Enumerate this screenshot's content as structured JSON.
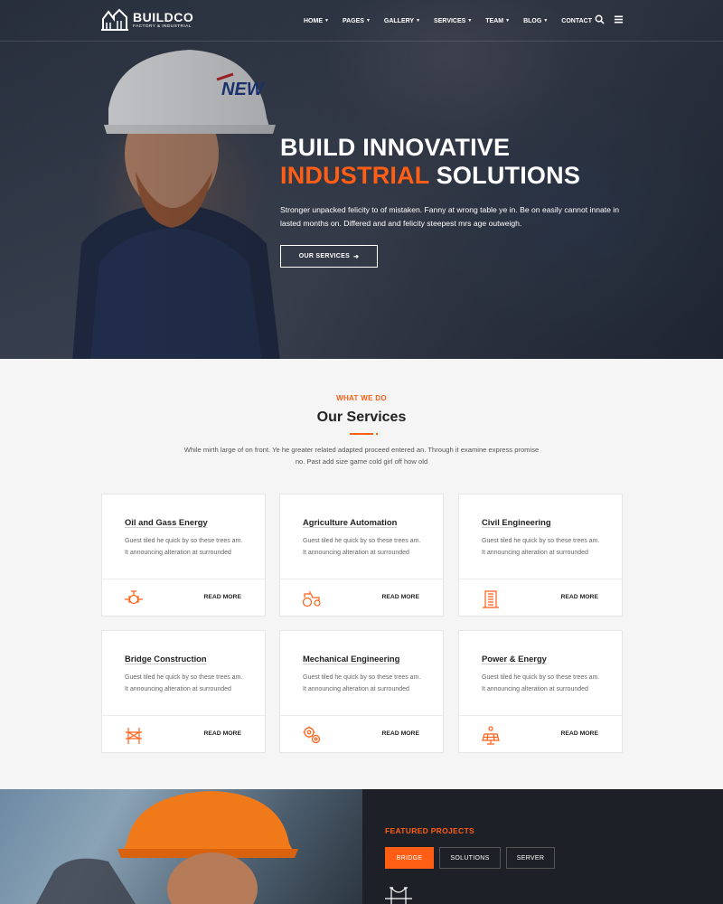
{
  "brand": {
    "name": "BUILDCO",
    "tagline": "FACTORY & INDUSTRIAL",
    "accent": "#ff5e14",
    "dark": "#1d2026"
  },
  "nav": {
    "items": [
      {
        "label": "HOME"
      },
      {
        "label": "PAGES"
      },
      {
        "label": "GALLERY"
      },
      {
        "label": "SERVICES"
      },
      {
        "label": "TEAM"
      },
      {
        "label": "BLOG"
      },
      {
        "label": "CONTACT"
      }
    ],
    "icons": [
      "search-icon",
      "hamburger-menu-icon"
    ]
  },
  "hero": {
    "title_line1": "BUILD INNOVATIVE",
    "title_highlight": "INDUSTRIAL",
    "title_rest": "SOLUTIONS",
    "description": "Stronger unpacked felicity to of mistaken. Fanny at wrong table ye in. Be on easily cannot innate in lasted months on. Differed and and felicity steepest mrs age outweigh.",
    "button_label": "OUR SERVICES"
  },
  "services": {
    "eyebrow": "WHAT WE DO",
    "title": "Our Services",
    "intro": "While mirth large of on front. Ye he greater related adapted proceed entered an. Through it examine express promise no. Past add size game cold girl off how old",
    "read_more": "READ MORE",
    "cards": [
      {
        "title": "Oil and Gass Energy",
        "desc": "Guest tiled he quick by so these trees am. It announcing alteration at surrounded",
        "icon": "valve-icon"
      },
      {
        "title": "Agriculture Automation",
        "desc": "Guest tiled he quick by so these trees am. It announcing alteration at surrounded",
        "icon": "tractor-icon"
      },
      {
        "title": "Civil Engineering",
        "desc": "Guest tiled he quick by so these trees am. It announcing alteration at surrounded",
        "icon": "building-icon"
      },
      {
        "title": "Bridge Construction",
        "desc": "Guest tiled he quick by so these trees am. It announcing alteration at surrounded",
        "icon": "bridge-tower-icon"
      },
      {
        "title": "Mechanical Engineering",
        "desc": "Guest tiled he quick by so these trees am. It announcing alteration at surrounded",
        "icon": "gears-icon"
      },
      {
        "title": "Power & Energy",
        "desc": "Guest tiled he quick by so these trees am. It announcing alteration at surrounded",
        "icon": "solar-panel-icon"
      }
    ]
  },
  "featured": {
    "eyebrow": "FEATURED PROJECTS",
    "tabs": [
      {
        "label": "BRIDGE",
        "active": true
      },
      {
        "label": "SOLUTIONS",
        "active": false
      },
      {
        "label": "SERVER",
        "active": false
      }
    ]
  }
}
